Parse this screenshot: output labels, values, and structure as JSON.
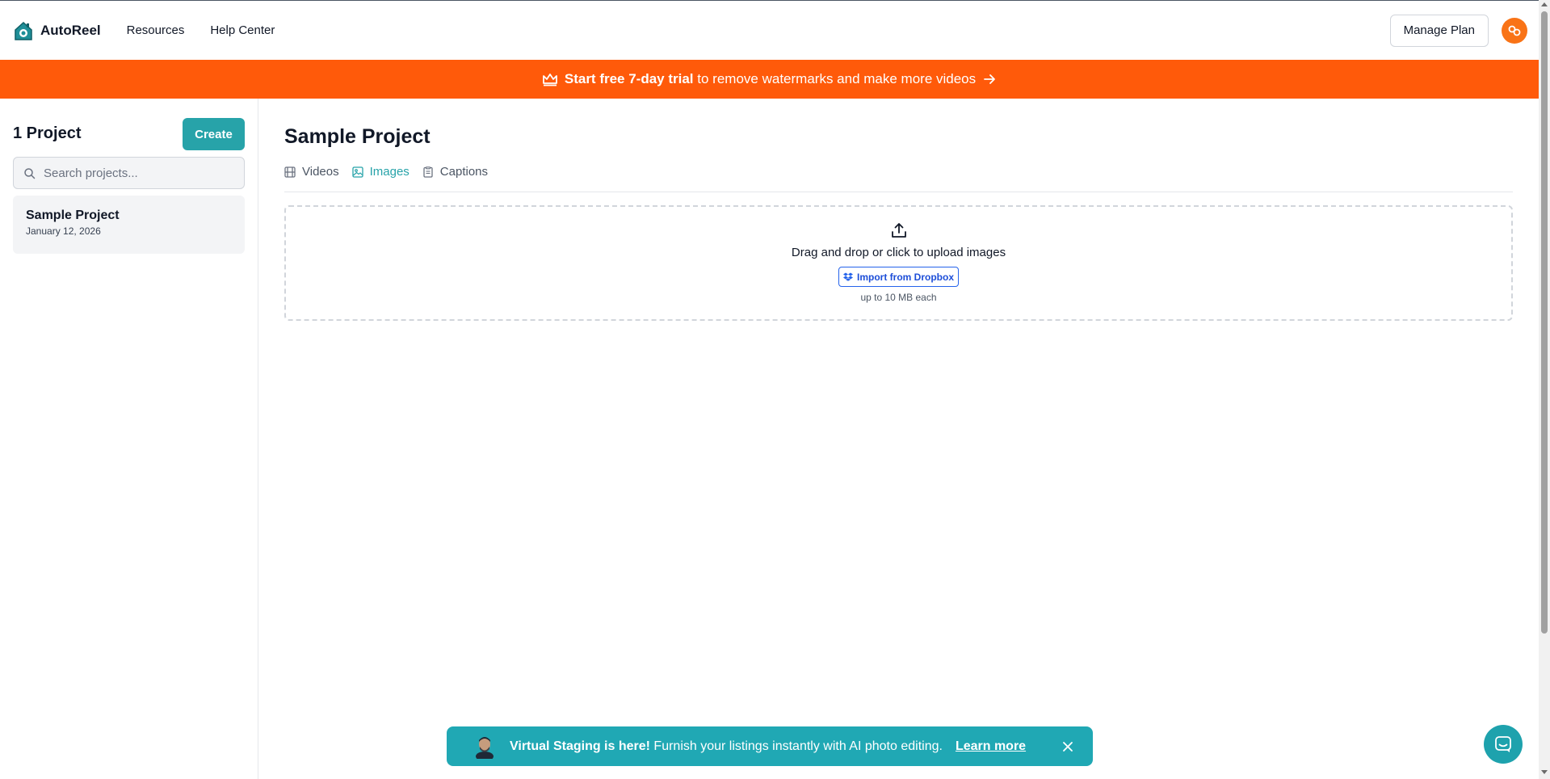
{
  "header": {
    "brand": "AutoReel",
    "nav": [
      "Resources",
      "Help Center"
    ],
    "manage_plan": "Manage Plan"
  },
  "promo": {
    "bold": "Start free 7-day trial",
    "rest": "to remove watermarks and make more videos"
  },
  "sidebar": {
    "count_label": "1 Project",
    "create_label": "Create",
    "search_placeholder": "Search projects...",
    "projects": [
      {
        "name": "Sample Project",
        "date": "January 12, 2026"
      }
    ]
  },
  "main": {
    "title": "Sample Project",
    "tabs": [
      {
        "label": "Videos",
        "icon": "film-icon",
        "active": false
      },
      {
        "label": "Images",
        "icon": "image-icon",
        "active": true
      },
      {
        "label": "Captions",
        "icon": "document-icon",
        "active": false
      }
    ],
    "dropzone": {
      "text": "Drag and drop or click to upload images",
      "dropbox_label": "Import from Dropbox",
      "limit": "up to 10 MB each"
    }
  },
  "toast": {
    "bold": "Virtual Staging is here!",
    "rest": "Furnish your listings instantly with AI photo editing.",
    "link": "Learn more"
  },
  "colors": {
    "accent": "#27a3a9",
    "promo": "#ff5a0a",
    "toast": "#20a8b4",
    "avatar": "#f97316",
    "dropbox": "#2563eb"
  }
}
